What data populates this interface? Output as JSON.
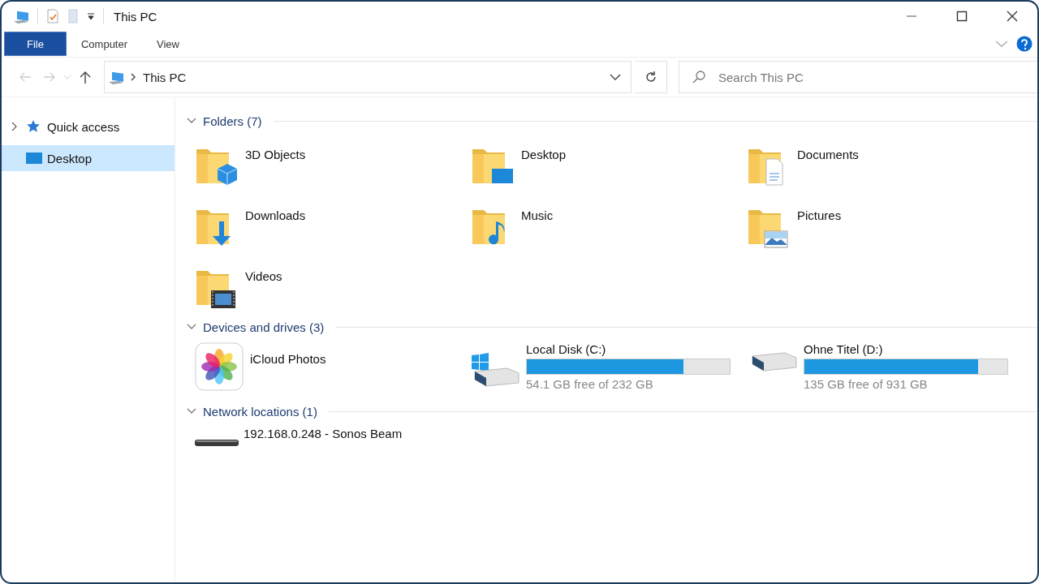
{
  "window": {
    "title": "This PC"
  },
  "ribbon_tabs": [
    {
      "label": "File",
      "selected": true
    },
    {
      "label": "Computer",
      "selected": false
    },
    {
      "label": "View",
      "selected": false
    }
  ],
  "address": {
    "path": "This PC"
  },
  "search": {
    "placeholder": "Search This PC"
  },
  "sidebar": {
    "items": [
      {
        "label": "Quick access",
        "kind": "star",
        "expanded": false,
        "selected": false
      },
      {
        "label": "Desktop",
        "kind": "desktop",
        "selected": true
      }
    ]
  },
  "sections": [
    {
      "title": "Folders (7)",
      "kind": "folders",
      "items": [
        {
          "name": "3D Objects",
          "kind": "cube"
        },
        {
          "name": "Desktop",
          "kind": "desktop"
        },
        {
          "name": "Documents",
          "kind": "documents"
        },
        {
          "name": "Downloads",
          "kind": "downloads"
        },
        {
          "name": "Music",
          "kind": "music"
        },
        {
          "name": "Pictures",
          "kind": "pictures"
        },
        {
          "name": "Videos",
          "kind": "videos"
        }
      ]
    },
    {
      "title": "Devices and drives (3)",
      "kind": "drives",
      "items": [
        {
          "name": "iCloud Photos",
          "kind": "app"
        },
        {
          "name": "Local Disk (C:)",
          "kind": "system-disk",
          "level": 0.77,
          "free": "54.1 GB free of 232 GB"
        },
        {
          "name": "Ohne Titel (D:)",
          "kind": "disk",
          "level": 0.855,
          "free": "135 GB free of 931 GB"
        }
      ]
    },
    {
      "title": "Network locations (1)",
      "kind": "network",
      "items": [
        {
          "name": "192.168.0.248 - Sonos Beam",
          "kind": "device"
        }
      ]
    }
  ]
}
